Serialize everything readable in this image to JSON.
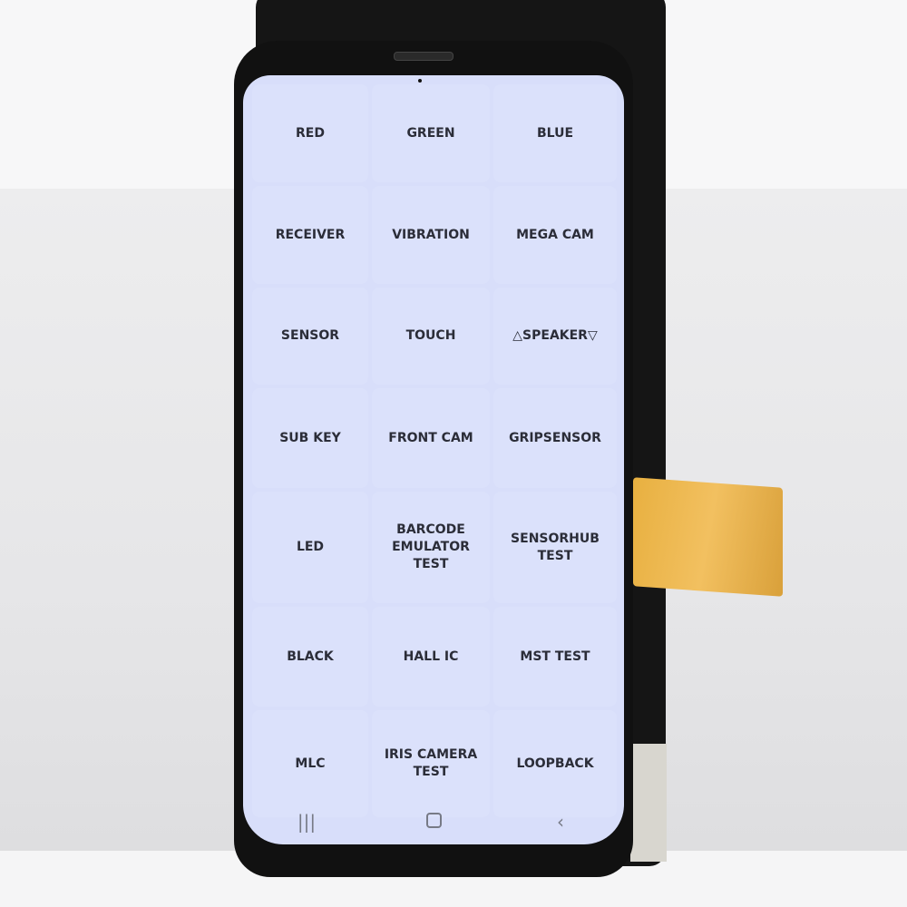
{
  "test_menu": {
    "items": [
      {
        "label": "RED"
      },
      {
        "label": "GREEN"
      },
      {
        "label": "BLUE"
      },
      {
        "label": "RECEIVER"
      },
      {
        "label": "VIBRATION"
      },
      {
        "label": "MEGA CAM"
      },
      {
        "label": "SENSOR"
      },
      {
        "label": "TOUCH"
      },
      {
        "label": "△SPEAKER▽"
      },
      {
        "label": "SUB KEY"
      },
      {
        "label": "FRONT CAM"
      },
      {
        "label": "GRIPSENSOR"
      },
      {
        "label": "LED"
      },
      {
        "label": "BARCODE EMULATOR TEST"
      },
      {
        "label": "SENSORHUB TEST"
      },
      {
        "label": "BLACK"
      },
      {
        "label": "HALL IC"
      },
      {
        "label": "MST TEST"
      },
      {
        "label": "MLC"
      },
      {
        "label": "IRIS CAMERA TEST"
      },
      {
        "label": "LOOPBACK"
      }
    ]
  },
  "nav_bar": {
    "recents_icon": "recents-icon",
    "home_icon": "home-icon",
    "back_icon": "back-icon"
  },
  "colors": {
    "screen": "#d8defa",
    "annotation_arrow": "#e8151b",
    "text": "#2b2d38"
  }
}
